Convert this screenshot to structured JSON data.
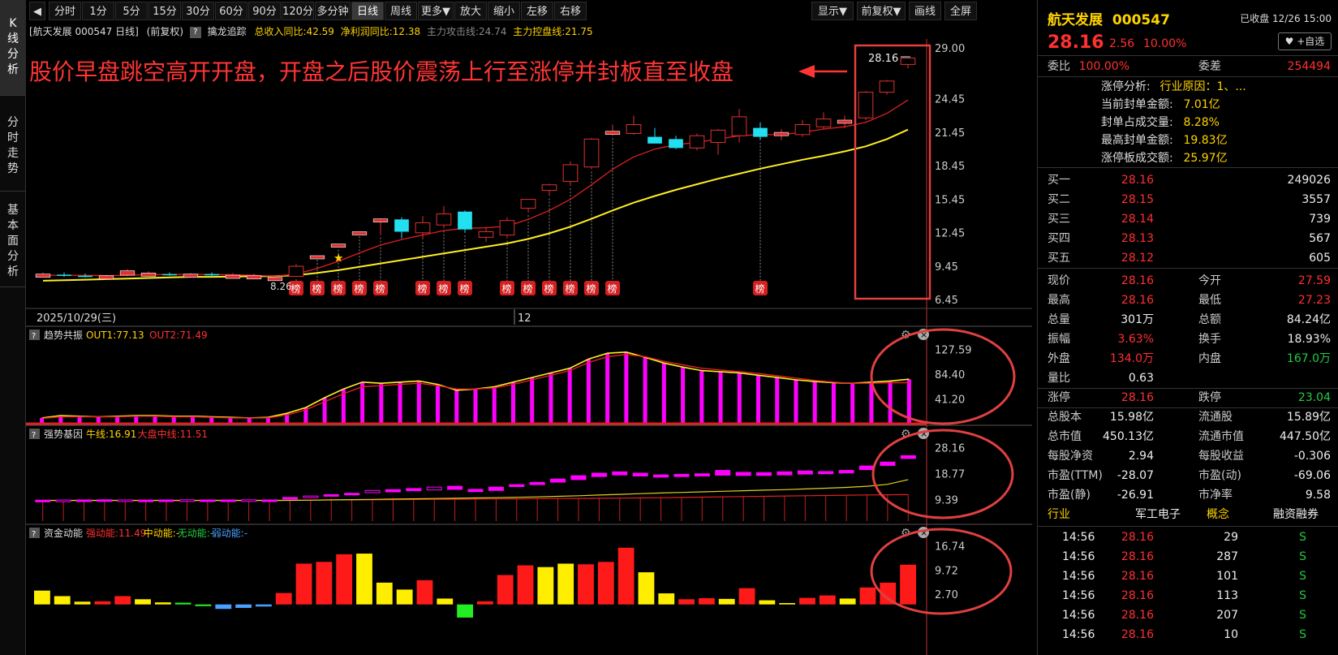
{
  "left_tabs": [
    "K线分析",
    "分时走势",
    "基本面分析"
  ],
  "toolbar": {
    "back_glyph": "◀",
    "buttons": [
      "分时",
      "1分",
      "5分",
      "15分",
      "30分",
      "60分",
      "90分",
      "120分",
      "多分钟",
      "日线",
      "周线",
      "更多▼",
      "放大",
      "缩小",
      "左移",
      "右移"
    ],
    "active": "日线",
    "right_buttons": [
      "显示▼",
      "前复权▼",
      "画线",
      "全屏"
    ]
  },
  "info_line": {
    "stock": "[航天发展 000547 日线]",
    "adjust": "(前复权)",
    "qmark": "?",
    "indicator": "擒龙追踪",
    "revenue_yoy": "总收入同比:42.59",
    "profit_yoy": "净利润同比:12.38",
    "attack_line": "主力攻击线:24.74",
    "control_line": "主力控盘线:21.75"
  },
  "annotation": {
    "text": "股价早盘跳空高开开盘，开盘之后股价震荡上行至涨停并封板直至收盘",
    "price_label": "28.16",
    "low_label": "8.26"
  },
  "main_axis": [
    "29.00",
    "24.45",
    "21.45",
    "18.45",
    "15.45",
    "12.45",
    "9.45",
    "6.45"
  ],
  "date_labels": [
    "2025/10/29(三)",
    "12"
  ],
  "badge_text": "榜",
  "panels": {
    "trend": {
      "title": "趋势共振",
      "out1": "OUT1:77.13",
      "out2": "OUT2:71.49",
      "axis": [
        "127.59",
        "84.40",
        "41.20"
      ]
    },
    "gene": {
      "title": "强势基因",
      "bull": "牛线:16.91",
      "market": "大盘中线:11.51",
      "axis": [
        "28.16",
        "18.77",
        "9.39"
      ]
    },
    "money": {
      "title": "资金动能",
      "strong": "强动能:11.49",
      "mid": "中动能:-",
      "none": "无动能:-",
      "weak": "弱动能:-",
      "axis": [
        "16.74",
        "9.72",
        "2.70"
      ]
    }
  },
  "chart_data": [
    {
      "type": "candlestick",
      "title": "",
      "y_axis_ticks": [
        29.0,
        24.45,
        21.45,
        18.45,
        15.45,
        12.45,
        9.45,
        6.45
      ],
      "ylim": [
        6.45,
        29.0
      ],
      "candles": [
        {
          "o": 8.7,
          "h": 8.95,
          "l": 8.55,
          "c": 8.8
        },
        {
          "o": 8.75,
          "h": 8.95,
          "l": 8.55,
          "c": 8.7,
          "cyan": true
        },
        {
          "o": 8.65,
          "h": 8.85,
          "l": 8.5,
          "c": 8.55,
          "cyan": true
        },
        {
          "o": 8.55,
          "h": 8.75,
          "l": 8.45,
          "c": 8.65
        },
        {
          "o": 8.7,
          "h": 9.25,
          "l": 8.6,
          "c": 9.1
        },
        {
          "o": 8.9,
          "h": 9.05,
          "l": 8.75,
          "c": 8.9
        },
        {
          "o": 8.8,
          "h": 8.95,
          "l": 8.65,
          "c": 8.8,
          "cyan": true
        },
        {
          "o": 8.8,
          "h": 8.9,
          "l": 8.6,
          "c": 8.7
        },
        {
          "o": 8.75,
          "h": 8.95,
          "l": 8.55,
          "c": 8.8,
          "cyan": true
        },
        {
          "o": 8.7,
          "h": 8.9,
          "l": 8.55,
          "c": 8.6
        },
        {
          "o": 8.65,
          "h": 8.85,
          "l": 8.45,
          "c": 8.6
        },
        {
          "o": 8.5,
          "h": 8.7,
          "l": 8.26,
          "c": 8.45
        },
        {
          "o": 8.6,
          "h": 9.7,
          "l": 8.55,
          "c": 9.5
        },
        {
          "o": 10.35,
          "h": 10.45,
          "l": 10.3,
          "c": 10.45
        },
        {
          "o": 11.3,
          "h": 11.5,
          "l": 11.2,
          "c": 11.5
        },
        {
          "o": 12.45,
          "h": 12.6,
          "l": 12.4,
          "c": 12.6
        },
        {
          "o": 13.75,
          "h": 13.8,
          "l": 12.3,
          "c": 13.75
        },
        {
          "o": 12.6,
          "h": 13.9,
          "l": 12.0,
          "c": 13.7,
          "cyan": true
        },
        {
          "o": 12.5,
          "h": 14.0,
          "l": 11.9,
          "c": 13.4
        },
        {
          "o": 13.2,
          "h": 14.9,
          "l": 12.9,
          "c": 14.2
        },
        {
          "o": 12.8,
          "h": 14.5,
          "l": 12.5,
          "c": 14.4,
          "cyan": true
        },
        {
          "o": 12.1,
          "h": 13.0,
          "l": 11.7,
          "c": 12.6
        },
        {
          "o": 12.3,
          "h": 13.9,
          "l": 12.0,
          "c": 13.6
        },
        {
          "o": 14.7,
          "h": 15.5,
          "l": 14.3,
          "c": 15.5
        },
        {
          "o": 16.3,
          "h": 16.9,
          "l": 15.8,
          "c": 16.8
        },
        {
          "o": 17.1,
          "h": 18.9,
          "l": 16.7,
          "c": 18.6
        },
        {
          "o": 18.4,
          "h": 21.0,
          "l": 18.2,
          "c": 20.9
        },
        {
          "o": 21.5,
          "h": 22.2,
          "l": 21.2,
          "c": 21.6
        },
        {
          "o": 21.4,
          "h": 23.0,
          "l": 21.3,
          "c": 22.2
        },
        {
          "o": 21.1,
          "h": 21.9,
          "l": 20.6,
          "c": 20.5,
          "cyan": true
        },
        {
          "o": 20.9,
          "h": 21.2,
          "l": 20.0,
          "c": 20.1,
          "cyan": true
        },
        {
          "o": 20.1,
          "h": 21.4,
          "l": 19.9,
          "c": 21.2
        },
        {
          "o": 20.6,
          "h": 21.8,
          "l": 19.5,
          "c": 21.7
        },
        {
          "o": 21.2,
          "h": 23.6,
          "l": 20.6,
          "c": 22.9
        },
        {
          "o": 21.9,
          "h": 22.4,
          "l": 20.8,
          "c": 21.1,
          "cyan": true
        },
        {
          "o": 21.2,
          "h": 21.8,
          "l": 20.8,
          "c": 21.5
        },
        {
          "o": 21.3,
          "h": 22.6,
          "l": 21.1,
          "c": 22.2
        },
        {
          "o": 22.0,
          "h": 23.3,
          "l": 21.8,
          "c": 22.7
        },
        {
          "o": 22.4,
          "h": 23.0,
          "l": 21.9,
          "c": 22.6
        },
        {
          "o": 22.8,
          "h": 25.2,
          "l": 22.6,
          "c": 25.1
        },
        {
          "o": 25.1,
          "h": 26.2,
          "l": 24.9,
          "c": 26.1
        },
        {
          "o": 27.59,
          "h": 28.16,
          "l": 27.23,
          "c": 28.16
        }
      ],
      "ma_red": [
        8.7,
        8.7,
        8.68,
        8.66,
        8.7,
        8.75,
        8.77,
        8.78,
        8.76,
        8.74,
        8.7,
        8.6,
        8.8,
        9.3,
        9.95,
        10.7,
        11.4,
        11.9,
        12.3,
        12.7,
        12.9,
        12.95,
        13.1,
        13.7,
        14.5,
        15.5,
        16.8,
        18.2,
        19.3,
        20.0,
        20.4,
        20.6,
        20.9,
        21.2,
        21.3,
        21.3,
        21.5,
        21.8,
        22.0,
        22.4,
        23.2,
        24.4
      ],
      "ma_yellow": [
        8.2,
        8.25,
        8.3,
        8.35,
        8.4,
        8.45,
        8.5,
        8.55,
        8.55,
        8.58,
        8.6,
        8.62,
        8.7,
        8.9,
        9.15,
        9.45,
        9.75,
        10.05,
        10.35,
        10.65,
        10.95,
        11.25,
        11.55,
        11.95,
        12.45,
        13.05,
        13.75,
        14.5,
        15.2,
        15.8,
        16.35,
        16.85,
        17.35,
        17.8,
        18.25,
        18.65,
        19.05,
        19.4,
        19.8,
        20.25,
        20.9,
        21.75
      ],
      "badge_indices": [
        12,
        13,
        14,
        15,
        16,
        18,
        19,
        20,
        22,
        23,
        24,
        25,
        26,
        27,
        34
      ]
    },
    {
      "type": "bar",
      "title": "趋势共振",
      "series": [
        {
          "name": "OUT1",
          "values": [
            10,
            14,
            13,
            12,
            13,
            14,
            14,
            13,
            13,
            12,
            11,
            10,
            11,
            18,
            28,
            45,
            60,
            72,
            70,
            72,
            74,
            68,
            58,
            60,
            64,
            72,
            80,
            88,
            96,
            112,
            122,
            124,
            115,
            105,
            98,
            92,
            90,
            88,
            84,
            80,
            76,
            73,
            71,
            70,
            72,
            74,
            77
          ]
        },
        {
          "name": "OUT2",
          "values": [
            9,
            12,
            12,
            12,
            12,
            13,
            13,
            12,
            12,
            11,
            10,
            10,
            10,
            15,
            24,
            38,
            52,
            64,
            66,
            68,
            70,
            66,
            60,
            60,
            62,
            68,
            76,
            84,
            92,
            106,
            116,
            120,
            116,
            108,
            102,
            96,
            93,
            90,
            87,
            83,
            79,
            75,
            72,
            70,
            70,
            71,
            71
          ]
        }
      ],
      "bars": [
        10,
        14,
        13,
        12,
        13,
        14,
        14,
        13,
        13,
        12,
        11,
        10,
        11,
        18,
        28,
        45,
        60,
        72,
        70,
        72,
        74,
        68,
        58,
        60,
        64,
        72,
        80,
        88,
        96,
        112,
        122,
        124,
        115,
        105,
        98,
        92,
        90,
        88,
        84,
        80,
        76,
        73,
        71,
        70,
        72,
        74,
        77
      ],
      "ylim": [
        0,
        135
      ]
    },
    {
      "type": "bar",
      "title": "强势基因",
      "boxes": [
        [
          9.4,
          9.5
        ],
        [
          9.45,
          9.55
        ],
        [
          9.5,
          9.6
        ],
        [
          9.55,
          9.65
        ],
        [
          9.5,
          9.6
        ],
        [
          9.45,
          9.55
        ],
        [
          9.5,
          9.6
        ],
        [
          9.55,
          9.65
        ],
        [
          9.5,
          9.6
        ],
        [
          9.5,
          9.6
        ],
        [
          9.55,
          9.65
        ],
        [
          9.5,
          9.6
        ],
        [
          10.0,
          10.5
        ],
        [
          10.5,
          11.0
        ],
        [
          11.0,
          11.5
        ],
        [
          11.5,
          12.0
        ],
        [
          12.2,
          13.0
        ],
        [
          12.5,
          13.3
        ],
        [
          12.9,
          13.7
        ],
        [
          13.2,
          14.2
        ],
        [
          13.4,
          14.5
        ],
        [
          12.6,
          13.4
        ],
        [
          13.0,
          14.2
        ],
        [
          14.4,
          15.1
        ],
        [
          15.1,
          15.9
        ],
        [
          16.0,
          17.1
        ],
        [
          16.9,
          18.3
        ],
        [
          18.0,
          19.2
        ],
        [
          18.6,
          19.7
        ],
        [
          18.2,
          19.2
        ],
        [
          17.8,
          18.6
        ],
        [
          18.0,
          18.8
        ],
        [
          18.2,
          19.0
        ],
        [
          18.5,
          20.2
        ],
        [
          18.4,
          19.5
        ],
        [
          18.4,
          19.4
        ],
        [
          18.6,
          19.7
        ],
        [
          18.9,
          20.0
        ],
        [
          19.0,
          19.8
        ],
        [
          19.3,
          20.2
        ],
        [
          20.5,
          21.8
        ],
        [
          22.0,
          23.2
        ],
        [
          24.5,
          25.5
        ]
      ],
      "bull_line": [
        9.4,
        9.4,
        9.4,
        9.4,
        9.4,
        9.4,
        9.4,
        9.4,
        9.4,
        9.4,
        9.4,
        9.4,
        9.45,
        9.5,
        9.6,
        9.7,
        9.8,
        9.9,
        10.0,
        10.1,
        10.2,
        10.3,
        10.4,
        10.55,
        10.7,
        10.9,
        11.1,
        11.35,
        11.6,
        11.85,
        12.1,
        12.3,
        12.5,
        12.7,
        12.9,
        13.1,
        13.3,
        13.55,
        13.8,
        14.1,
        14.5,
        15.2,
        16.91
      ],
      "market_line": [
        9.5,
        9.5,
        9.5,
        9.5,
        9.5,
        9.5,
        9.5,
        9.5,
        9.5,
        9.5,
        9.5,
        9.5,
        9.5,
        9.55,
        9.6,
        9.6,
        9.65,
        9.7,
        9.75,
        9.8,
        9.85,
        9.9,
        9.95,
        10.0,
        10.05,
        10.1,
        10.15,
        10.2,
        10.25,
        10.3,
        10.4,
        10.5,
        10.6,
        10.7,
        10.8,
        10.9,
        11.0,
        11.1,
        11.2,
        11.3,
        11.4,
        11.45,
        11.51
      ],
      "ylim": [
        2,
        30
      ]
    },
    {
      "type": "bar",
      "title": "资金动能",
      "values": [
        4.0,
        2.4,
        0.8,
        0.9,
        2.4,
        1.5,
        0.6,
        0.5,
        -0.5,
        -1.3,
        -1.0,
        -0.6,
        3.3,
        11.8,
        12.3,
        14.5,
        14.7,
        6.3,
        4.3,
        7.0,
        1.7,
        -3.8,
        0.9,
        8.5,
        11.3,
        10.8,
        11.8,
        11.6,
        12.3,
        16.4,
        9.3,
        3.2,
        1.5,
        1.8,
        1.6,
        4.7,
        1.2,
        0.4,
        1.9,
        2.6,
        1.7,
        4.9,
        6.3,
        11.49
      ],
      "colors": [
        "y",
        "y",
        "y",
        "r",
        "r",
        "y",
        "y",
        "g",
        "g",
        "b",
        "b",
        "b",
        "r",
        "r",
        "r",
        "r",
        "y",
        "y",
        "y",
        "r",
        "y",
        "g",
        "r",
        "r",
        "r",
        "y",
        "y",
        "r",
        "r",
        "r",
        "y",
        "y",
        "r",
        "r",
        "y",
        "r",
        "y",
        "y",
        "r",
        "r",
        "y",
        "r",
        "r",
        "r"
      ],
      "ylim": [
        -5,
        18
      ]
    }
  ],
  "right_panel": {
    "name": "航天发展",
    "code": "000547",
    "status": "已收盘 12/26 15:00",
    "price": "28.16",
    "change": "2.56",
    "pct": "10.00%",
    "watch_btn": "♥ +自选",
    "webi_l": "委比",
    "webi_v": "100.00%",
    "weicha_l": "委差",
    "weicha_v": "254494",
    "limit_info": [
      {
        "l": "涨停分析:",
        "v": "行业原因：1、..."
      },
      {
        "l": "当前封单金额:",
        "v": "7.01亿"
      },
      {
        "l": "封单占成交量:",
        "v": "8.28%"
      },
      {
        "l": "最高封单金额:",
        "v": "19.83亿"
      },
      {
        "l": "涨停板成交额:",
        "v": "25.97亿"
      }
    ],
    "buys": [
      {
        "l": "买一",
        "p": "28.16",
        "q": "249026"
      },
      {
        "l": "买二",
        "p": "28.15",
        "q": "3557"
      },
      {
        "l": "买三",
        "p": "28.14",
        "q": "739"
      },
      {
        "l": "买四",
        "p": "28.13",
        "q": "567"
      },
      {
        "l": "买五",
        "p": "28.12",
        "q": "605"
      }
    ],
    "stats": [
      {
        "l1": "现价",
        "v1": "28.16",
        "c1": "red",
        "l2": "今开",
        "v2": "27.59",
        "c2": "red"
      },
      {
        "l1": "最高",
        "v1": "28.16",
        "c1": "red",
        "l2": "最低",
        "v2": "27.23",
        "c2": "red"
      },
      {
        "l1": "总量",
        "v1": "301万",
        "c1": "white",
        "l2": "总额",
        "v2": "84.24亿",
        "c2": "white"
      },
      {
        "l1": "振幅",
        "v1": "3.63%",
        "c1": "red",
        "l2": "换手",
        "v2": "18.93%",
        "c2": "white"
      },
      {
        "l1": "外盘",
        "v1": "134.0万",
        "c1": "red",
        "l2": "内盘",
        "v2": "167.0万",
        "c2": "green"
      },
      {
        "l1": "量比",
        "v1": "0.63",
        "c1": "white",
        "l2": "",
        "v2": "",
        "c2": "white"
      },
      {
        "l1": "涨停",
        "v1": "28.16",
        "c1": "red",
        "l2": "跌停",
        "v2": "23.04",
        "c2": "green"
      },
      {
        "l1": "总股本",
        "v1": "15.98亿",
        "c1": "white",
        "l2": "流通股",
        "v2": "15.89亿",
        "c2": "white"
      },
      {
        "l1": "总市值",
        "v1": "450.13亿",
        "c1": "white",
        "l2": "流通市值",
        "v2": "447.50亿",
        "c2": "white"
      },
      {
        "l1": "每股净资",
        "v1": "2.94",
        "c1": "white",
        "l2": "每股收益",
        "v2": "-0.306",
        "c2": "white"
      },
      {
        "l1": "市盈(TTM)",
        "v1": "-28.07",
        "c1": "white",
        "l2": "市盈(动)",
        "v2": "-69.06",
        "c2": "white"
      },
      {
        "l1": "市盈(静)",
        "v1": "-26.91",
        "c1": "white",
        "l2": "市净率",
        "v2": "9.58",
        "c2": "white"
      }
    ],
    "industry_row": {
      "l1": "行业",
      "v1": "军工电子",
      "l2": "概念",
      "v2": "融资融券"
    },
    "ticks": [
      {
        "t": "14:56",
        "p": "28.16",
        "q": "29",
        "s": "S"
      },
      {
        "t": "14:56",
        "p": "28.16",
        "q": "287",
        "s": "S"
      },
      {
        "t": "14:56",
        "p": "28.16",
        "q": "101",
        "s": "S"
      },
      {
        "t": "14:56",
        "p": "28.16",
        "q": "113",
        "s": "S"
      },
      {
        "t": "14:56",
        "p": "28.16",
        "q": "207",
        "s": "S"
      },
      {
        "t": "14:56",
        "p": "28.16",
        "q": "10",
        "s": "S"
      }
    ]
  }
}
